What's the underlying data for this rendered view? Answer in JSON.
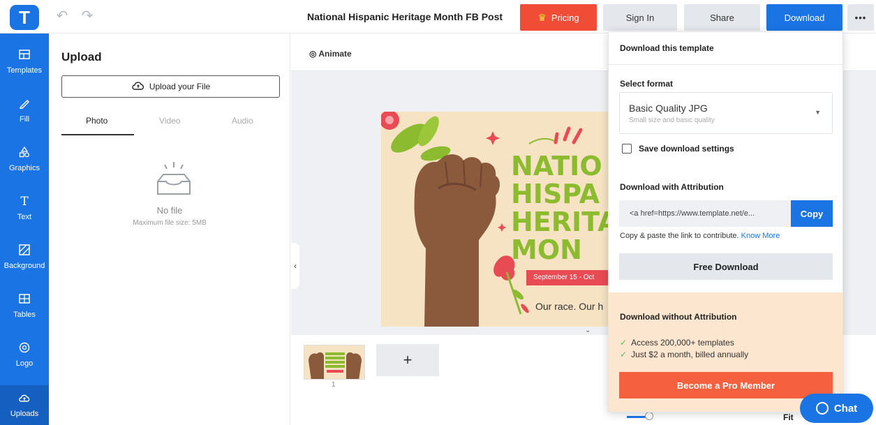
{
  "app": {
    "logo_letter": "T",
    "document_title": "National Hispanic Heritage Month FB Post"
  },
  "toolbar": {
    "undo": "↶",
    "redo": "↷",
    "pricing_label": "Pricing",
    "signin_label": "Sign In",
    "share_label": "Share",
    "download_label": "Download",
    "more_label": "•••"
  },
  "sidebar": {
    "items": [
      {
        "label": "Templates",
        "icon": "templates-icon"
      },
      {
        "label": "Fill",
        "icon": "pencil-icon"
      },
      {
        "label": "Graphics",
        "icon": "shapes-icon"
      },
      {
        "label": "Text",
        "icon": "text-icon"
      },
      {
        "label": "Background",
        "icon": "background-icon"
      },
      {
        "label": "Tables",
        "icon": "table-icon"
      },
      {
        "label": "Logo",
        "icon": "logo-icon"
      },
      {
        "label": "Uploads",
        "icon": "upload-cloud-icon"
      }
    ]
  },
  "upload_panel": {
    "title": "Upload",
    "upload_button": "Upload your File",
    "tabs": [
      "Photo",
      "Video",
      "Audio"
    ],
    "empty_title": "No file",
    "empty_hint": "Maximum file size: 5MB"
  },
  "canvas": {
    "animate_label": "Animate",
    "poster_headline": [
      "NATIO",
      "HISPA",
      "HERITA",
      "MON"
    ],
    "poster_date": "September 15 - Oct",
    "poster_tagline": "Our race. Our h",
    "page_number": "1",
    "add_page": "+",
    "fit_label": "Fit"
  },
  "download_dropdown": {
    "header": "Download this template",
    "select_format_label": "Select format",
    "format_value": "Basic Quality JPG",
    "format_sub": "Small size and basic quality",
    "save_settings_label": "Save download settings",
    "attribution_label": "Download with Attribution",
    "attribution_code": "<a href=https://www.template.net/e...",
    "copy_label": "Copy",
    "hint_text": "Copy & paste the link to contribute.",
    "know_more": "Know More",
    "free_download": "Free Download",
    "without_attribution": "Download without Attribution",
    "features": [
      "Access 200,000+ templates",
      "Just $2 a month, billed annually"
    ],
    "pro_button": "Become a Pro Member"
  },
  "chat": {
    "label": "Chat"
  },
  "colors": {
    "brand_blue": "#1b74e4",
    "pricing_red": "#f04c36",
    "pro_orange": "#f5613f",
    "pro_bg": "#fce6cf",
    "headline_green": "#8dbb2f"
  }
}
